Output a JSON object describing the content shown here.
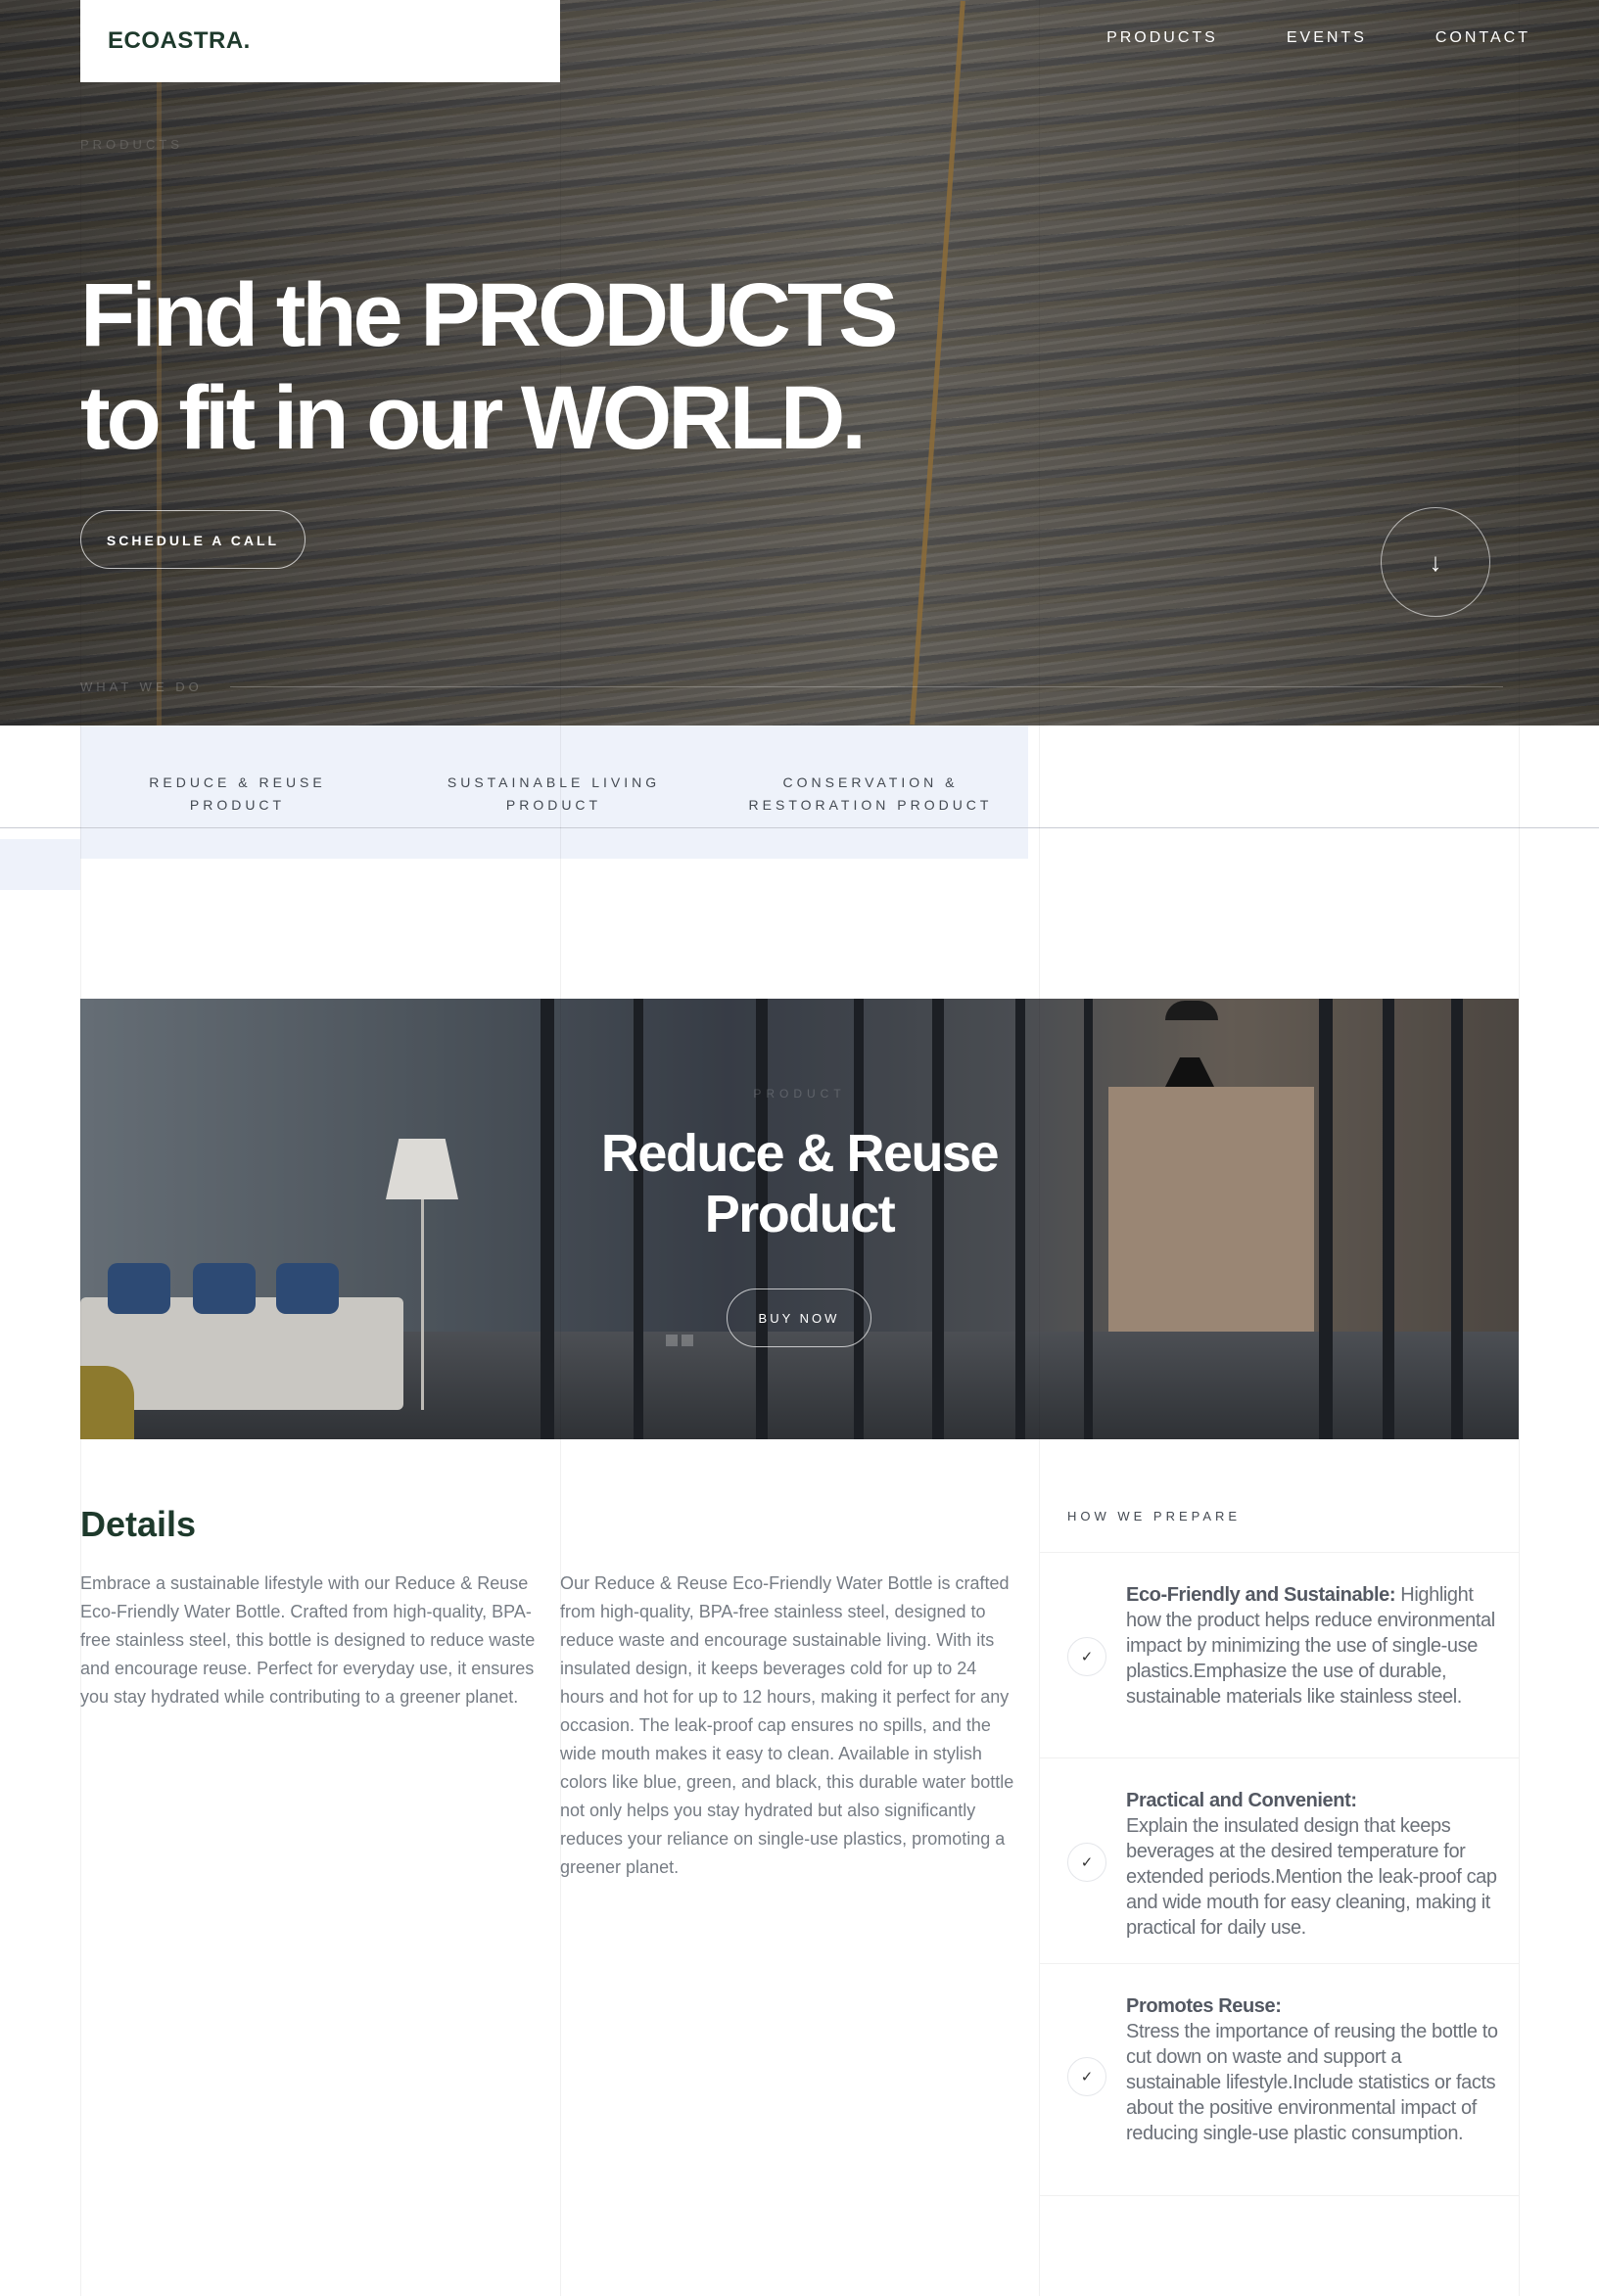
{
  "brand": {
    "logo": "ECOASTRA."
  },
  "nav": {
    "items": [
      "PRODUCTS",
      "EVENTS",
      "CONTACT"
    ]
  },
  "hero": {
    "small_label": "PRODUCTS",
    "title_line1": "Find the PRODUCTS",
    "title_line2": "to fit in our WORLD.",
    "cta_label": "SCHEDULE A CALL",
    "scroll_icon": "arrow-down-icon",
    "section_label": "WHAT WE DO"
  },
  "tabs": [
    {
      "line1": "REDUCE & REUSE",
      "line2": "PRODUCT"
    },
    {
      "line1": "SUSTAINABLE LIVING",
      "line2": "PRODUCT"
    },
    {
      "line1": "CONSERVATION &",
      "line2": "RESTORATION PRODUCT"
    }
  ],
  "product": {
    "label": "PRODUCT",
    "title_line1": "Reduce & Reuse",
    "title_line2": "Product",
    "buy_label": "BUY NOW"
  },
  "details": {
    "title": "Details",
    "paragraph1": "Embrace a sustainable lifestyle with our Reduce & Reuse Eco-Friendly Water Bottle. Crafted from high-quality, BPA-free stainless steel, this bottle is designed to reduce waste and encourage reuse. Perfect for everyday use, it ensures you stay hydrated while contributing to a greener planet.",
    "paragraph2": "Our Reduce & Reuse Eco-Friendly Water Bottle is crafted from high-quality, BPA-free stainless steel, designed to reduce waste and encourage sustainable living. With its insulated design, it keeps beverages cold for up to 24 hours and hot for up to 12 hours, making it perfect for any occasion. The leak-proof cap ensures no spills, and the wide mouth makes it easy to clean. Available in stylish colors like blue, green, and black, this durable water bottle not only helps you stay hydrated but also significantly reduces your reliance on single-use plastics, promoting a greener planet."
  },
  "prepare": {
    "label": "HOW WE PREPARE",
    "items": [
      {
        "title": "Eco-Friendly and Sustainable:",
        "text": " Highlight how the product helps reduce environmental impact by minimizing the use of single-use plastics.Emphasize the use of durable, sustainable materials like stainless steel."
      },
      {
        "title": "Practical and Convenient:",
        "text": "Explain the insulated design that keeps beverages at the desired temperature for extended periods.Mention the leak-proof cap and wide mouth for easy cleaning, making it practical for daily use."
      },
      {
        "title": "Promotes Reuse:",
        "text": "Stress the importance of reusing the bottle to cut down on waste and support a sustainable lifestyle.Include statistics or facts about the positive environmental impact of reducing single-use plastic consumption."
      }
    ]
  },
  "colors": {
    "brand_green": "#1e3a2c",
    "tab_bg": "#eef2fa",
    "body_text": "#767c84"
  }
}
